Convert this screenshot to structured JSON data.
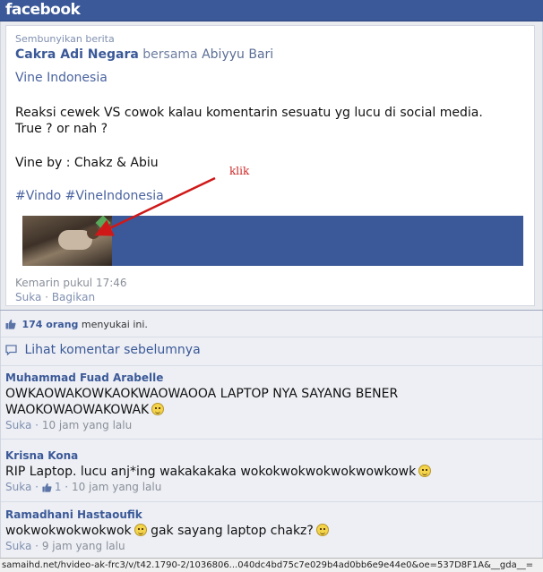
{
  "brand": {
    "logo_text": "facebook",
    "color": "#3b5998"
  },
  "story": {
    "hide_label": "Sembunyikan berita",
    "author": "Cakra Adi Negara",
    "with_text": "bersama",
    "tagged": "Abiyyu Bari",
    "page_name": "Vine Indonesia",
    "message_line1": "Reaksi cewek VS cowok kalau komentarin sesuatu yg lucu di social media.",
    "message_line2": "True ? or nah ?",
    "message_line3": "Vine by : Chakz & Abiu",
    "hashtags": "#Vindo #VineIndonesia",
    "annotation": "klik",
    "timestamp": "Kemarin pukul 17:46",
    "like_label": "Suka",
    "separator": "·",
    "share_label": "Bagikan"
  },
  "likes": {
    "count": "174 orang",
    "suffix": "menyukai ini."
  },
  "previous_comments_label": "Lihat komentar sebelumnya",
  "comments": [
    {
      "author": "Muhammad Fuad Arabelle",
      "text_line1": "OWKAOWAKOWKAOKWAOWAOOA LAPTOP NYA SAYANG BENER",
      "text_line2": "WAOKOWAOWAKOWAK",
      "like_label": "Suka",
      "separator": "·",
      "time": "10 jam yang lalu"
    },
    {
      "author": "Krisna Kona",
      "text": "RIP Laptop. lucu anj*ing wakakakaka wokokwokwokwokwowkowk",
      "like_label": "Suka",
      "separator": "·",
      "like_count": "1",
      "time": "10 jam yang lalu"
    },
    {
      "author": "Ramadhani Hastaoufik",
      "text_part1": "wokwokwokwokwok",
      "text_part2": "gak sayang laptop chakz?",
      "like_label": "Suka",
      "separator": "·",
      "time": "9 jam yang lalu"
    }
  ],
  "status_bar": {
    "url": "samaihd.net/hvideo-ak-frc3/v/t42.1790-2/1036806...040dc4bd75c7e029b4ad0bb6e9e44e0&oe=537D8F1A&__gda__="
  }
}
